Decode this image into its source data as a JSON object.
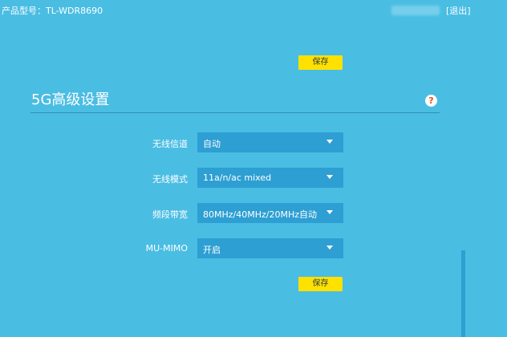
{
  "header": {
    "model": "产品型号：TL-WDR8690",
    "logout": "[退出]"
  },
  "save_label": "保存",
  "section": {
    "title": "5G高级设置",
    "help": "?"
  },
  "settings": [
    {
      "label": "无线信道",
      "value": "自动"
    },
    {
      "label": "无线模式",
      "value": "11a/n/ac mixed"
    },
    {
      "label": "频段带宽",
      "value": "80MHz/40MHz/20MHz自动"
    },
    {
      "label": "MU-MIMO",
      "value": "开启"
    }
  ],
  "colors": {
    "background": "#4abde3",
    "select_bg": "#2d9fd3",
    "save_button": "#ffe100",
    "help_icon": "#e2531d"
  }
}
